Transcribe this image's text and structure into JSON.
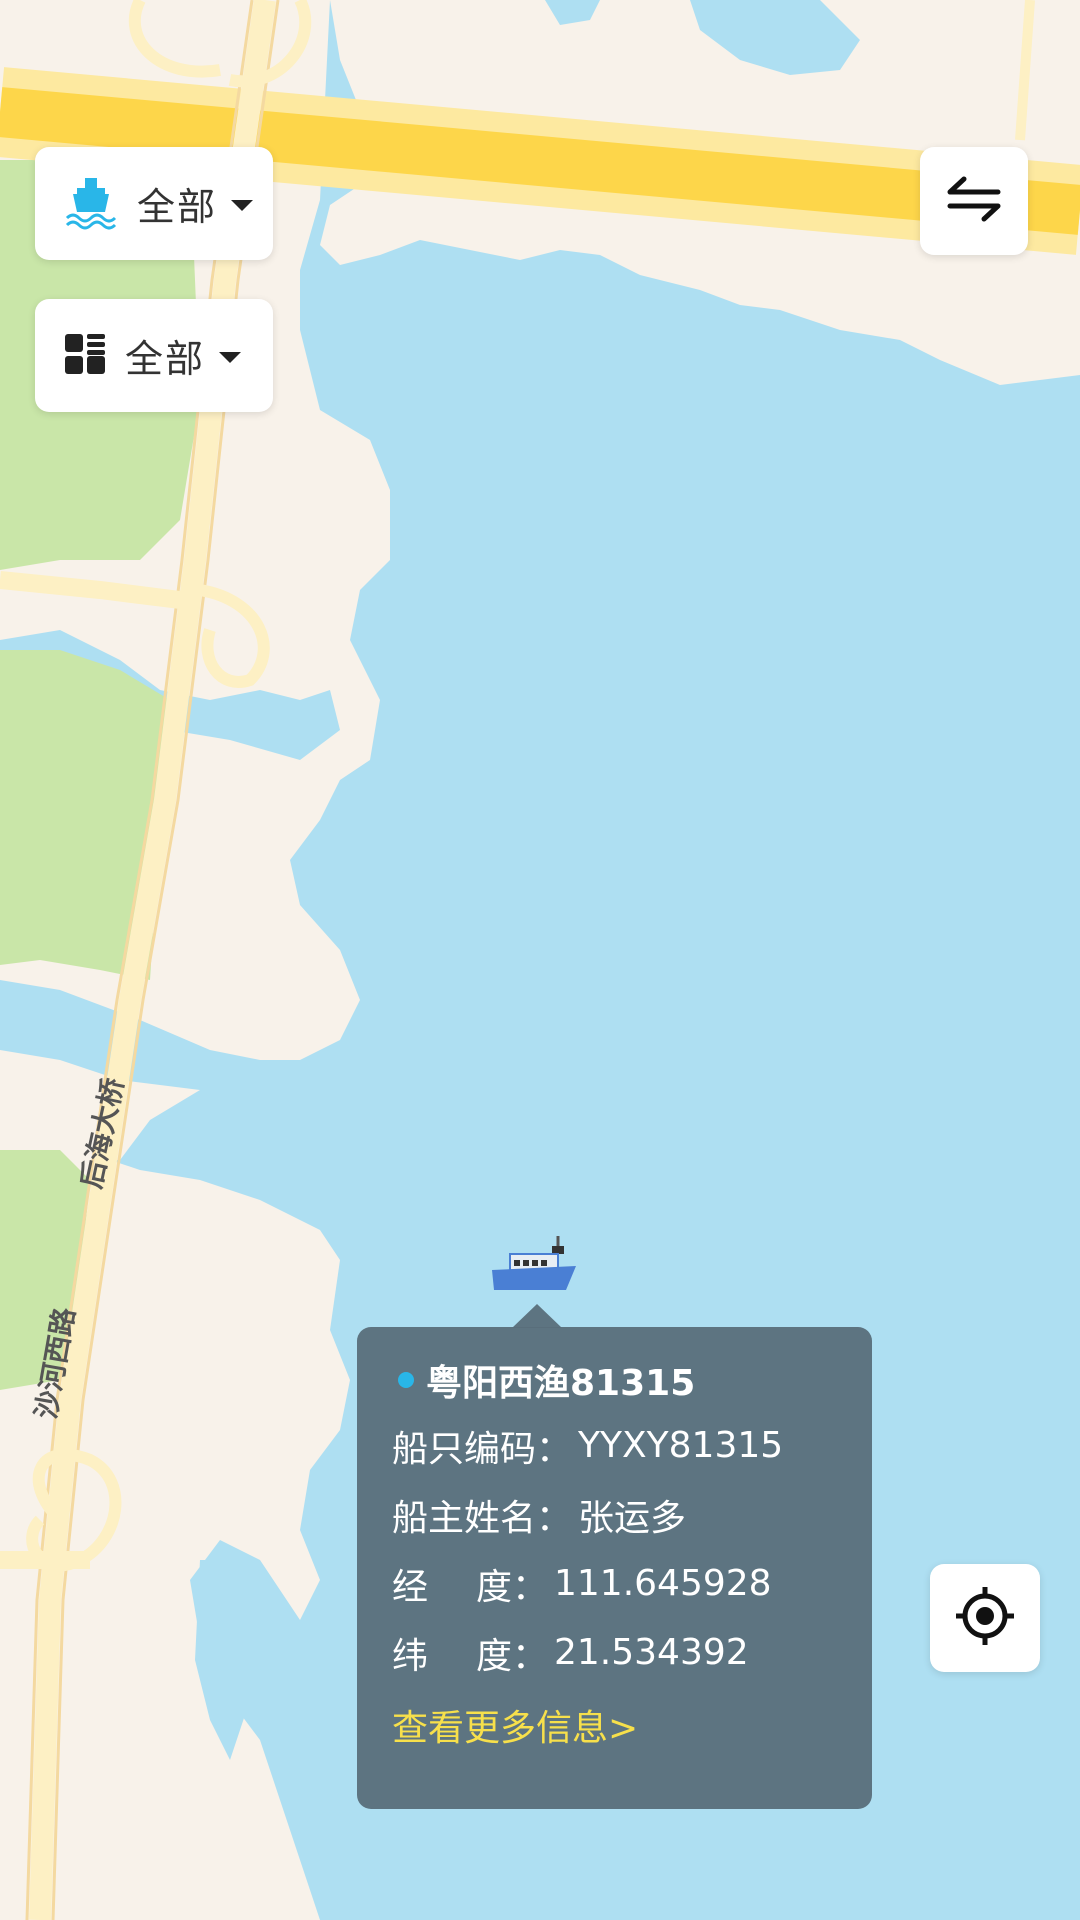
{
  "map": {
    "road_labels": [
      "后海大桥",
      "沙河西路"
    ],
    "colors": {
      "water": "#aedff2",
      "land": "#f8f2ea",
      "park": "#c9e6a8",
      "highway": "#fdd64a",
      "road": "#fdf0c4"
    }
  },
  "filters": {
    "vessel_type": {
      "label": "全部",
      "icon": "ship-icon"
    },
    "category": {
      "label": "全部",
      "icon": "grid-icon"
    }
  },
  "controls": {
    "swap": {
      "icon": "swap-arrows-icon"
    },
    "locate": {
      "icon": "crosshair-locate-icon"
    }
  },
  "vessel": {
    "icon": "fishing-boat-icon",
    "name": "粤阳西渔81315",
    "status_color": "#29b6e8",
    "code_label": "船只编码：",
    "code": "YYXY81315",
    "owner_label": "船主姓名：",
    "owner": "张运多",
    "lng_label_a": "经",
    "lng_label_b": "度：",
    "lng": "111.645928",
    "lat_label_a": "纬",
    "lat_label_b": "度：",
    "lat": "21.534392",
    "more_link": "查看更多信息>"
  }
}
